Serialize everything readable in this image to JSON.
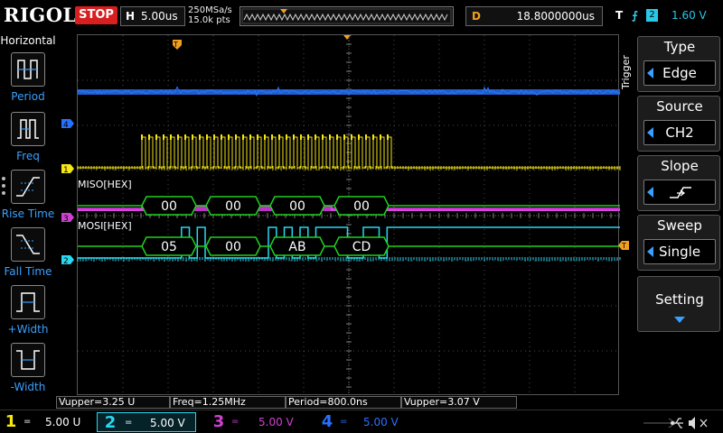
{
  "header": {
    "brand": "RIGOL",
    "run_state": "STOP",
    "timebase_label": "H",
    "timebase_value": "5.00us",
    "sample_rate": "250MSa/s",
    "memory_depth": "15.0k pts",
    "delay_label": "D",
    "delay_value": "18.8000000us",
    "trigger_label": "T",
    "trigger_source": "2",
    "trigger_level": "1.60 V"
  },
  "left_menu": {
    "title": "Horizontal",
    "items": [
      {
        "label": "Period",
        "icon": "period-icon"
      },
      {
        "label": "Freq",
        "icon": "freq-icon"
      },
      {
        "label": "Rise Time",
        "icon": "rise-time-icon"
      },
      {
        "label": "Fall Time",
        "icon": "fall-time-icon"
      },
      {
        "label": "+Width",
        "icon": "positive-width-icon"
      },
      {
        "label": "-Width",
        "icon": "negative-width-icon"
      }
    ]
  },
  "right_menu": {
    "side_label": "Trigger",
    "type": {
      "title": "Type",
      "value": "Edge"
    },
    "source": {
      "title": "Source",
      "value": "CH2"
    },
    "slope": {
      "title": "Slope",
      "icon": "rising-edge-icon"
    },
    "sweep": {
      "title": "Sweep",
      "value": "Single"
    },
    "setting": {
      "title": "Setting"
    }
  },
  "decode": {
    "miso_label": "MISO[HEX]",
    "mosi_label": "MOSI[HEX]",
    "miso_bytes": [
      "00",
      "00",
      "00",
      "00"
    ],
    "mosi_bytes": [
      "05",
      "00",
      "AB",
      "CD"
    ]
  },
  "channel_markers": {
    "ch1": "1",
    "ch2": "2",
    "ch3": "3",
    "ch4": "4",
    "trigger_marker": "T"
  },
  "measurements": [
    "Vupper=3.25 U",
    "Freq=1.25MHz",
    "Period=800.0ns",
    "Vupper=3.07 V"
  ],
  "channels": [
    {
      "num": "1",
      "coupling": "=",
      "scale": "5.00 U",
      "color": "#f5e614"
    },
    {
      "num": "2",
      "coupling": "=",
      "scale": "5.00 V",
      "color": "#28d8f0"
    },
    {
      "num": "3",
      "coupling": "=",
      "scale": "5.00 V",
      "color": "#d040d0"
    },
    {
      "num": "4",
      "coupling": "=",
      "scale": "5.00 V",
      "color": "#2a70ff"
    }
  ],
  "colors": {
    "ch1": "#f5e614",
    "ch2": "#28d8f0",
    "ch3": "#d040d0",
    "ch4": "#2a70ff",
    "decode_bus": "#20d020",
    "trigger_orange": "#f0a020"
  }
}
